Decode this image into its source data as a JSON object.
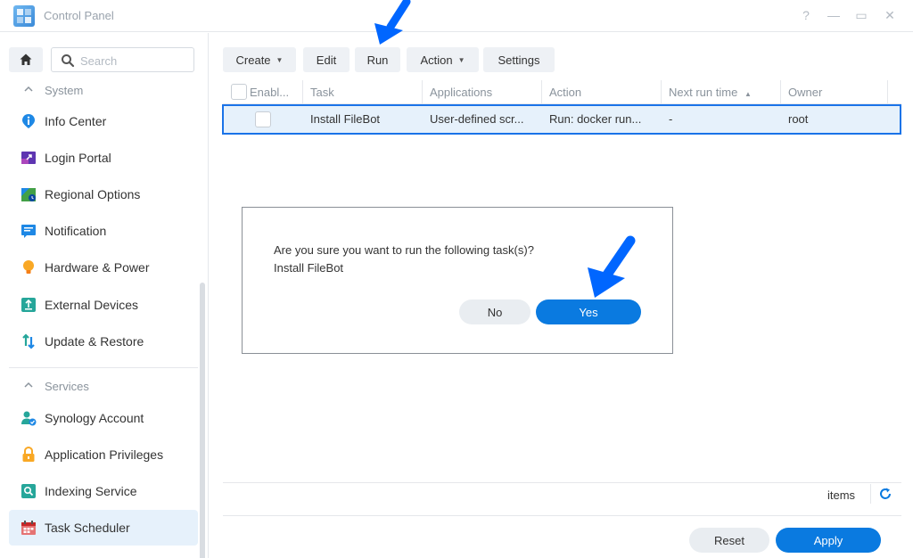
{
  "window": {
    "title": "Control Panel",
    "controls": {
      "help": "?",
      "minimize": "—",
      "maximize": "▭",
      "close": "✕"
    }
  },
  "sidebar": {
    "search_placeholder": "Search",
    "sections": [
      {
        "label": "System",
        "items": [
          {
            "label": "Info Center",
            "icon": "info-icon"
          },
          {
            "label": "Login Portal",
            "icon": "login-portal-icon"
          },
          {
            "label": "Regional Options",
            "icon": "regional-options-icon"
          },
          {
            "label": "Notification",
            "icon": "notification-icon"
          },
          {
            "label": "Hardware & Power",
            "icon": "lightbulb-icon"
          },
          {
            "label": "External Devices",
            "icon": "external-devices-icon"
          },
          {
            "label": "Update & Restore",
            "icon": "update-restore-icon"
          }
        ]
      },
      {
        "label": "Services",
        "items": [
          {
            "label": "Synology Account",
            "icon": "account-icon"
          },
          {
            "label": "Application Privileges",
            "icon": "lock-icon"
          },
          {
            "label": "Indexing Service",
            "icon": "indexing-icon"
          },
          {
            "label": "Task Scheduler",
            "icon": "calendar-icon",
            "active": true
          }
        ]
      }
    ]
  },
  "toolbar": {
    "create": "Create",
    "edit": "Edit",
    "run": "Run",
    "action": "Action",
    "settings": "Settings"
  },
  "table": {
    "columns": [
      "Enabl...",
      "Task",
      "Applications",
      "Action",
      "Next run time",
      "Owner"
    ],
    "sort_indicator": "▲",
    "rows": [
      {
        "enabled": false,
        "task": "Install FileBot",
        "applications": "User-defined scr...",
        "action": "Run: docker run...",
        "next_run_time": "-",
        "owner": "root"
      }
    ]
  },
  "footer": {
    "items_label": "items",
    "reset": "Reset",
    "apply": "Apply"
  },
  "dialog": {
    "message": "Are you sure you want to run the following task(s)?",
    "task": "Install FileBot",
    "no": "No",
    "yes": "Yes"
  },
  "colors": {
    "accent": "#0a7ae0",
    "selection_border": "#1a73e8",
    "selection_bg": "#e6f1fb",
    "annotation_arrow": "#0066ff"
  }
}
